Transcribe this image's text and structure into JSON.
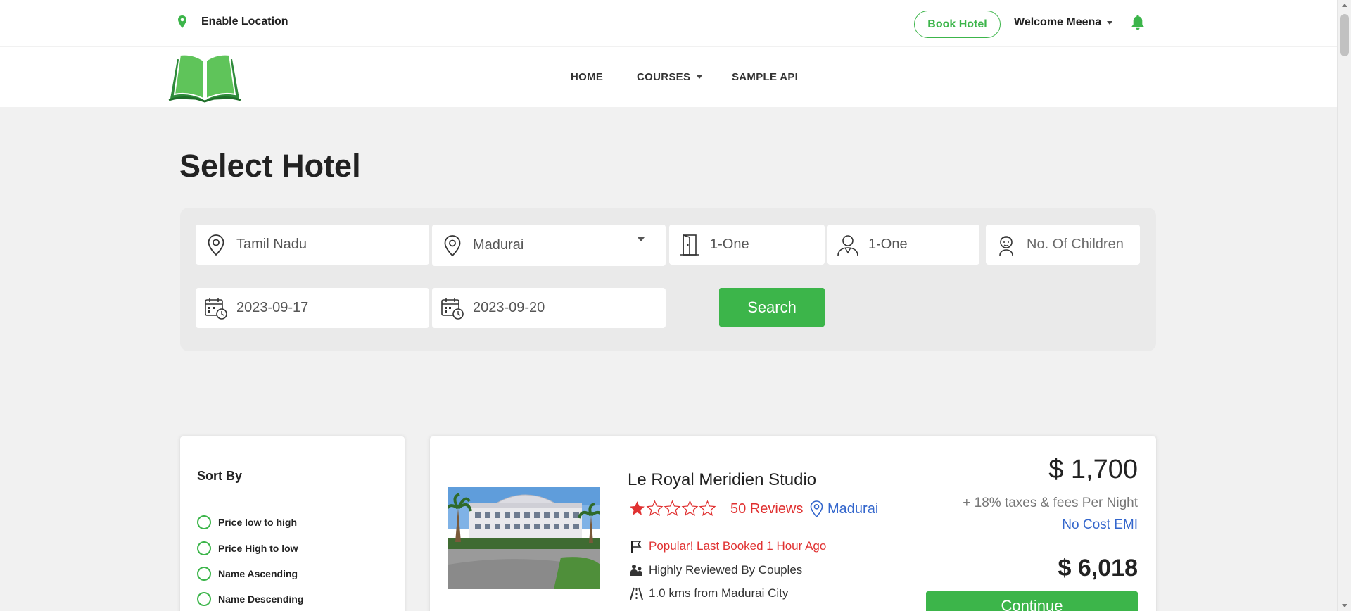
{
  "topbar": {
    "location_label": "Enable Location",
    "book_hotel_label": "Book Hotel",
    "welcome_label": "Welcome Meena"
  },
  "nav": {
    "items": [
      {
        "label": "HOME"
      },
      {
        "label": "COURSES"
      },
      {
        "label": "SAMPLE API"
      }
    ]
  },
  "page": {
    "title": "Select Hotel"
  },
  "search": {
    "state": "Tamil Nadu",
    "city": "Madurai",
    "rooms": "1-One",
    "adults": "1-One",
    "children_placeholder": "No. Of Children",
    "checkin": "2023-09-17",
    "checkout": "2023-09-20",
    "search_label": "Search"
  },
  "sort": {
    "title": "Sort By",
    "options": [
      {
        "label": "Price low to high"
      },
      {
        "label": "Price High to low"
      },
      {
        "label": "Name Ascending"
      },
      {
        "label": "Name Descending"
      }
    ]
  },
  "hotel": {
    "name": "Le Royal Meridien Studio",
    "rating": 1,
    "rating_max": 5,
    "reviews": "50 Reviews",
    "city": "Madurai",
    "features": [
      {
        "icon": "flag-icon",
        "text": "Popular! Last Booked 1 Hour Ago"
      },
      {
        "icon": "couple-icon",
        "text": "Highly Reviewed By Couples"
      },
      {
        "icon": "road-icon",
        "text": "1.0 kms from Madurai City"
      }
    ],
    "price": "$ 1,700",
    "tax_note": "+ 18% taxes & fees Per Night",
    "emi": "No Cost EMI",
    "total": "$ 6,018",
    "continue_label": "Continue"
  },
  "colors": {
    "brand_green": "#3cb54a",
    "link_blue": "#3366cc",
    "alert_red": "#e03131"
  }
}
